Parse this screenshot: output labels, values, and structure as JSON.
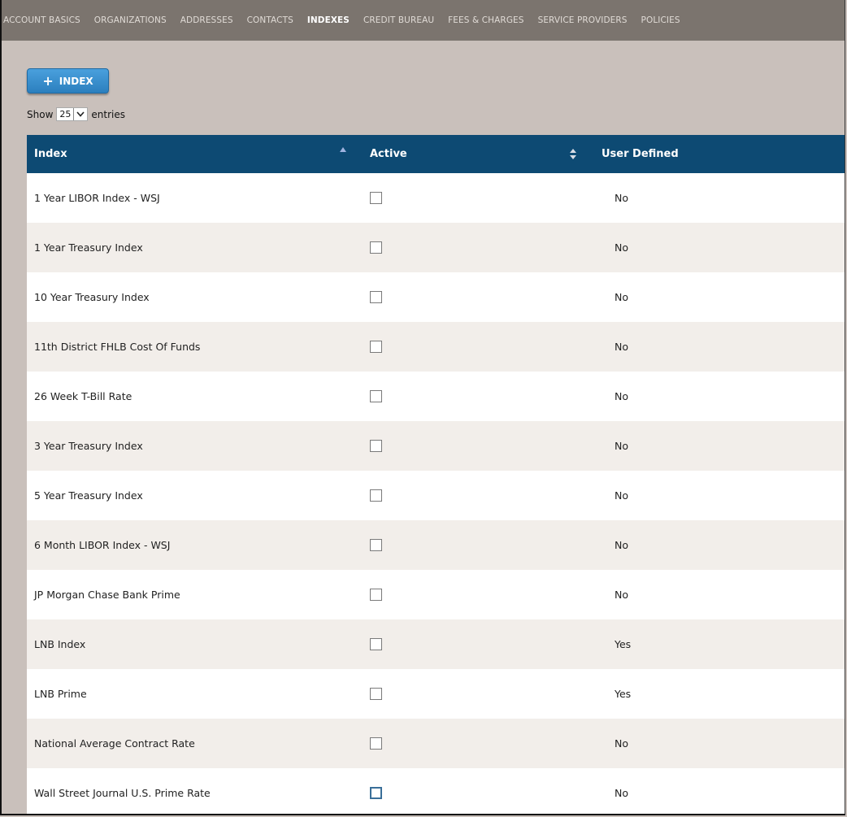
{
  "nav": {
    "tabs": [
      {
        "label": "ACCOUNT BASICS",
        "active": false
      },
      {
        "label": "ORGANIZATIONS",
        "active": false
      },
      {
        "label": "ADDRESSES",
        "active": false
      },
      {
        "label": "CONTACTS",
        "active": false
      },
      {
        "label": "INDEXES",
        "active": true
      },
      {
        "label": "CREDIT BUREAU",
        "active": false
      },
      {
        "label": "FEES & CHARGES",
        "active": false
      },
      {
        "label": "SERVICE PROVIDERS",
        "active": false
      },
      {
        "label": "POLICIES",
        "active": false
      }
    ]
  },
  "toolbar": {
    "add_label": "INDEX",
    "add_icon": "plus-icon"
  },
  "entries": {
    "show_label": "Show",
    "value": "25",
    "suffix_label": "entries"
  },
  "table": {
    "headers": {
      "index": "Index",
      "active": "Active",
      "user_defined": "User Defined"
    },
    "rows": [
      {
        "index": "1 Year LIBOR Index - WSJ",
        "active": false,
        "user_defined": "No"
      },
      {
        "index": "1 Year Treasury Index",
        "active": false,
        "user_defined": "No"
      },
      {
        "index": "10 Year Treasury Index",
        "active": false,
        "user_defined": "No"
      },
      {
        "index": "11th District FHLB Cost Of Funds",
        "active": false,
        "user_defined": "No"
      },
      {
        "index": "26 Week T-Bill Rate",
        "active": false,
        "user_defined": "No"
      },
      {
        "index": "3 Year Treasury Index",
        "active": false,
        "user_defined": "No"
      },
      {
        "index": "5 Year Treasury Index",
        "active": false,
        "user_defined": "No"
      },
      {
        "index": "6 Month LIBOR Index - WSJ",
        "active": false,
        "user_defined": "No"
      },
      {
        "index": "JP Morgan Chase Bank Prime",
        "active": false,
        "user_defined": "No"
      },
      {
        "index": "LNB Index",
        "active": false,
        "user_defined": "Yes"
      },
      {
        "index": "LNB Prime",
        "active": false,
        "user_defined": "Yes"
      },
      {
        "index": "National Average Contract Rate",
        "active": false,
        "user_defined": "No"
      },
      {
        "index": "Wall Street Journal U.S. Prime Rate",
        "active": false,
        "user_defined": "No"
      }
    ]
  },
  "colors": {
    "nav_bg": "#7b746e",
    "page_bg": "#c9c0bb",
    "header_bg": "#0d4a73",
    "button_bg": "#3a8fd0",
    "row_alt_bg": "#f2eeea"
  }
}
